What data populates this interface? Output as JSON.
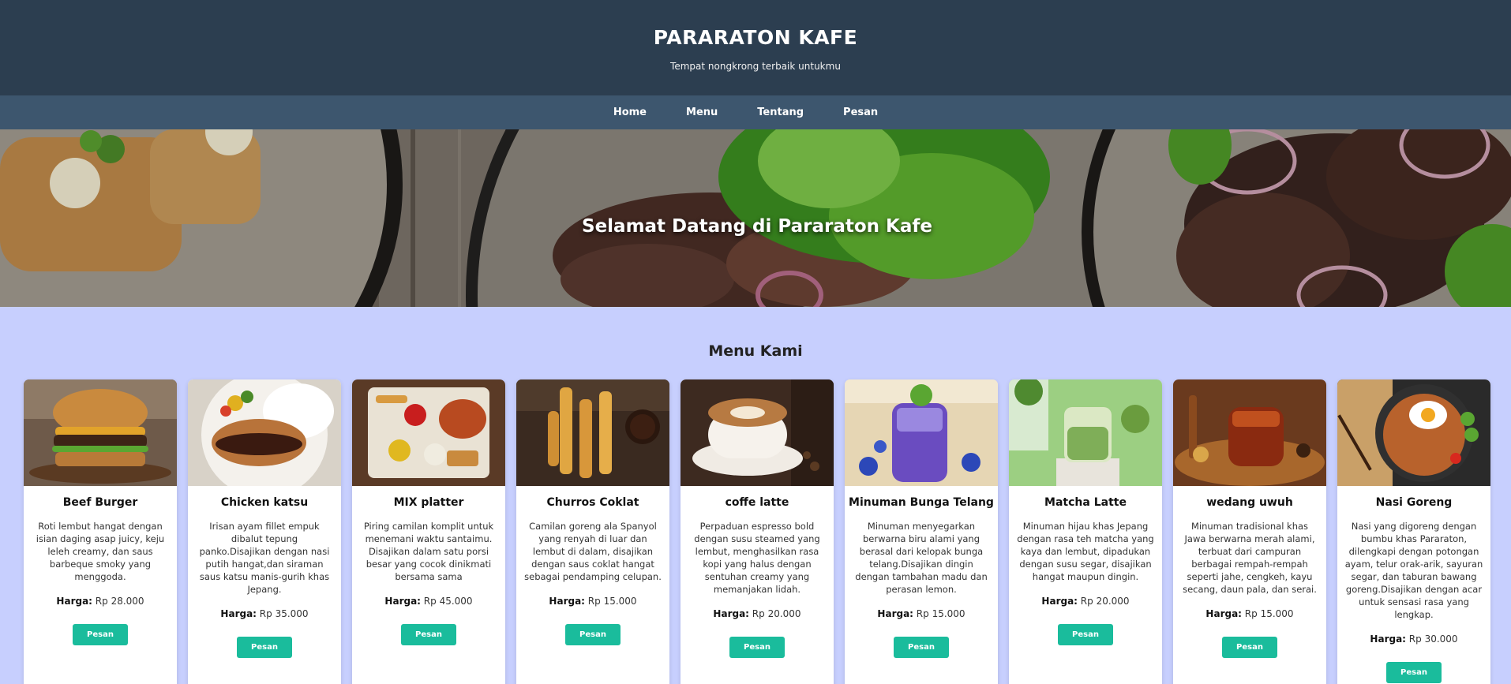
{
  "header": {
    "title": "PARARATON KAFE",
    "tagline": "Tempat nongkrong terbaik untukmu"
  },
  "nav": {
    "items": [
      "Home",
      "Menu",
      "Tentang",
      "Pesan"
    ]
  },
  "hero": {
    "title": "Selamat Datang di Pararaton Kafe"
  },
  "menu": {
    "heading": "Menu Kami",
    "price_label": "Harga:",
    "button_label": "Pesan",
    "items": [
      {
        "name": "Beef Burger",
        "desc": "Roti lembut hangat dengan isian daging asap juicy, keju leleh creamy, dan saus barbeque smoky yang menggoda.",
        "price": "Rp 28.000",
        "image": "beef-burger-photo"
      },
      {
        "name": "Chicken katsu",
        "desc": "Irisan ayam fillet empuk dibalut tepung panko.Disajikan dengan nasi putih hangat,dan siraman saus katsu manis-gurih khas Jepang.",
        "price": "Rp 35.000",
        "image": "chicken-katsu-photo"
      },
      {
        "name": "MIX platter",
        "desc": "Piring camilan komplit untuk menemani waktu santaimu. Disajikan dalam satu porsi besar yang cocok dinikmati bersama sama",
        "price": "Rp 45.000",
        "image": "mix-platter-photo"
      },
      {
        "name": "Churros Coklat",
        "desc": "Camilan goreng ala Spanyol yang renyah di luar dan lembut di dalam, disajikan dengan saus coklat hangat sebagai pendamping celupan.",
        "price": "Rp 15.000",
        "image": "churros-photo"
      },
      {
        "name": "coffe latte",
        "desc": "Perpaduan espresso bold dengan susu steamed yang lembut, menghasilkan rasa kopi yang halus dengan sentuhan creamy yang memanjakan lidah.",
        "price": "Rp 20.000",
        "image": "coffee-latte-photo"
      },
      {
        "name": "Minuman Bunga Telang",
        "desc": "Minuman menyegarkan berwarna biru alami yang berasal dari kelopak bunga telang.Disajikan dingin dengan tambahan madu dan perasan lemon.",
        "price": "Rp 15.000",
        "image": "butterfly-pea-drink-photo"
      },
      {
        "name": "Matcha Latte",
        "desc": "Minuman hijau khas Jepang dengan rasa teh matcha yang kaya dan lembut, dipadukan dengan susu segar, disajikan hangat maupun dingin.",
        "price": "Rp 20.000",
        "image": "matcha-latte-photo"
      },
      {
        "name": "wedang uwuh",
        "desc": "Minuman tradisional khas Jawa berwarna merah alami, terbuat dari campuran berbagai rempah-rempah seperti jahe, cengkeh, kayu secang, daun pala, dan serai.",
        "price": "Rp 15.000",
        "image": "wedang-uwuh-photo"
      },
      {
        "name": "Nasi Goreng",
        "desc": "Nasi yang digoreng dengan bumbu khas Pararaton, dilengkapi dengan potongan ayam, telur orak-arik, sayuran segar, dan taburan bawang goreng.Disajikan dengan acar untuk sensasi rasa yang lengkap.",
        "price": "Rp 30.000",
        "image": "nasi-goreng-photo"
      }
    ]
  },
  "colors": {
    "header_bg": "#2c3e50",
    "nav_bg": "#3d566e",
    "page_bg": "#c7cffe",
    "button_bg": "#1abc9c"
  }
}
